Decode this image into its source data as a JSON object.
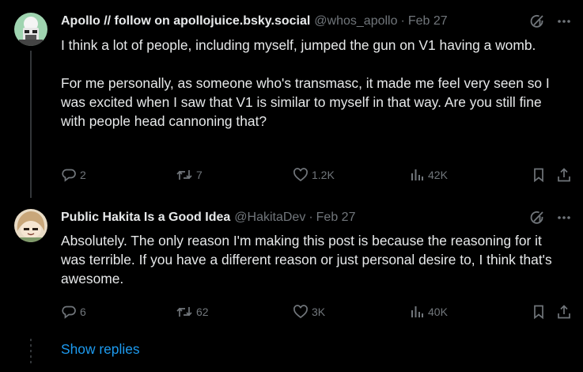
{
  "posts": [
    {
      "author_name": "Apollo // follow on apollojuice.bsky.social",
      "handle": "@whos_apollo",
      "separator": "·",
      "date": "Feb 27",
      "avatar_icon": "robot-avatar-icon",
      "paragraphs": [
        "I think a lot of people, including myself, jumped the gun on V1 having a womb.",
        "For me personally, as someone who's transmasc, it made me feel very seen so I was excited when I saw that V1 is similar to myself in that way. Are you still fine with people head cannoning that?"
      ],
      "stats": {
        "replies": "2",
        "reposts": "7",
        "likes": "1.2K",
        "views": "42K"
      }
    },
    {
      "author_name": "Public Hakita Is a Good Idea",
      "handle": "@HakitaDev",
      "separator": "·",
      "date": "Feb 27",
      "avatar_icon": "anime-character-avatar-icon",
      "paragraphs": [
        "Absolutely. The only reason I'm making this post is because the reasoning for it was terrible. If you have a different reason or just personal desire to, I think that's awesome."
      ],
      "stats": {
        "replies": "6",
        "reposts": "62",
        "likes": "3K",
        "views": "40K"
      }
    }
  ],
  "show_replies_label": "Show replies",
  "icons": {
    "grok": "grok-icon",
    "more": "more-icon",
    "reply": "reply-icon",
    "repost": "repost-icon",
    "like": "heart-icon",
    "views": "views-icon",
    "bookmark": "bookmark-icon",
    "share": "share-icon"
  },
  "colors": {
    "background": "#000000",
    "text": "#e7e9ea",
    "muted": "#71767b",
    "link": "#1d9bf0"
  }
}
